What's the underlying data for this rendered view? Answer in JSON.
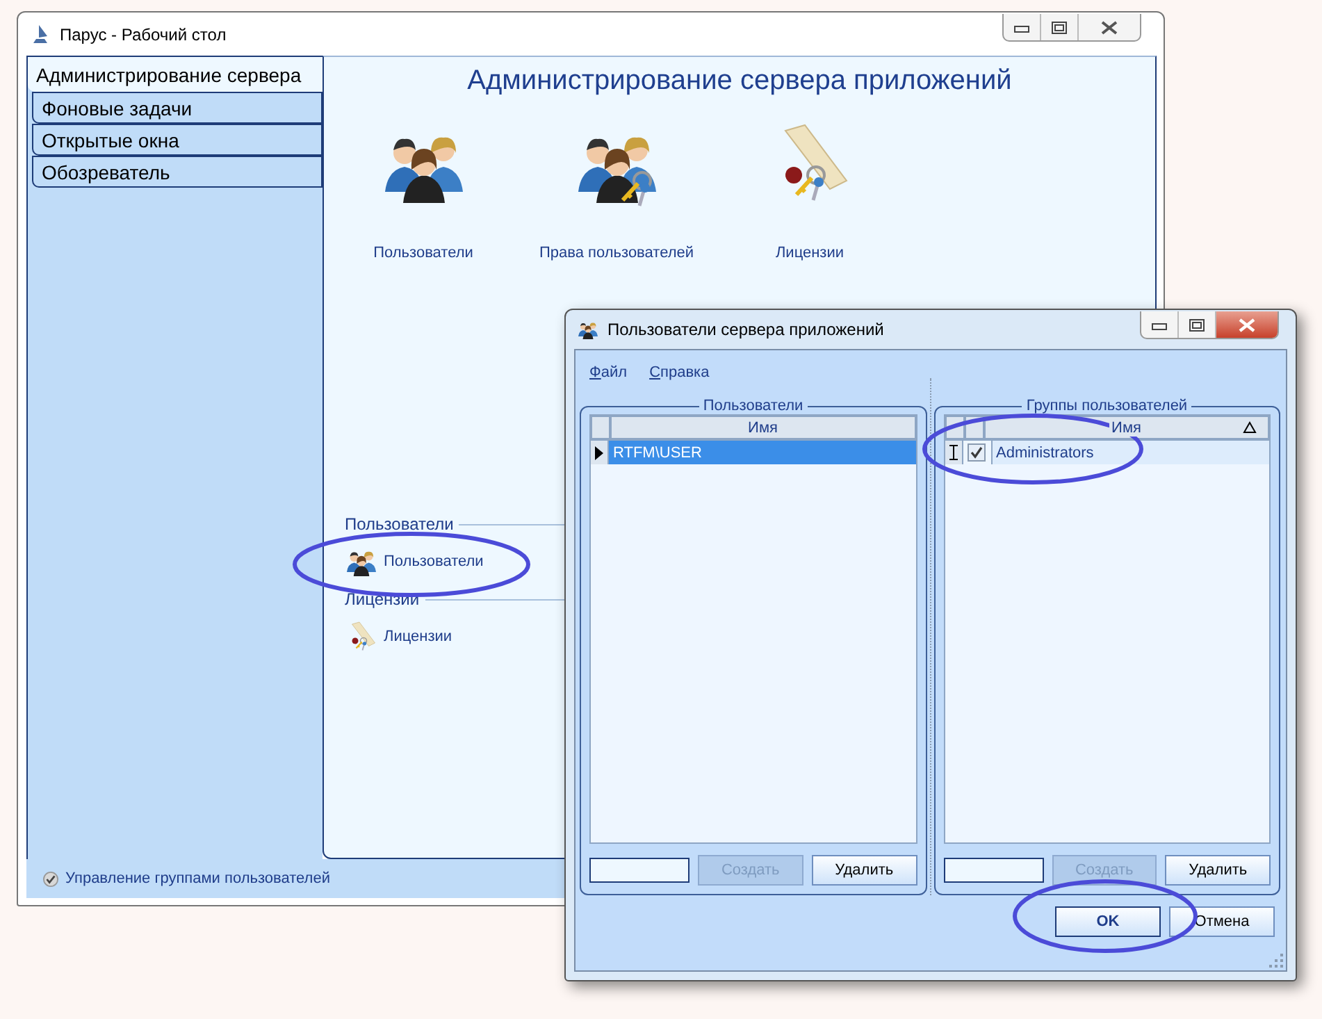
{
  "main_window": {
    "title": "Парус - Рабочий стол"
  },
  "sidebar": {
    "tabs": [
      {
        "label": "Администрирование сервера",
        "selected": true
      },
      {
        "label": "Фоновые задачи",
        "selected": false
      },
      {
        "label": "Открытые окна",
        "selected": false
      },
      {
        "label": "Обозреватель",
        "selected": false
      }
    ]
  },
  "content": {
    "heading": "Администрирование сервера приложений",
    "tiles": [
      {
        "label": "Пользователи",
        "kind": "users"
      },
      {
        "label": "Права пользователей",
        "kind": "rights"
      },
      {
        "label": "Лицензии",
        "kind": "licenses"
      }
    ],
    "sections": [
      {
        "title": "Пользователи",
        "items": [
          {
            "label": "Пользователи",
            "kind": "users"
          }
        ]
      },
      {
        "title": "Лицензии",
        "items": [
          {
            "label": "Лицензии",
            "kind": "licenses"
          }
        ]
      }
    ]
  },
  "status_bar": {
    "text": "Управление группами пользователей"
  },
  "dialog": {
    "title": "Пользователи сервера приложений",
    "menu": [
      "Файл",
      "Справка"
    ],
    "users_panel": {
      "title": "Пользователи",
      "columns": [
        {
          "label": "Имя",
          "sorted": false
        }
      ],
      "rows": [
        {
          "name": "RTFM\\USER",
          "selected": true
        }
      ],
      "buttons": [
        {
          "label": "Создать",
          "disabled": true
        },
        {
          "label": "Удалить",
          "disabled": false
        }
      ]
    },
    "groups_panel": {
      "title": "Группы пользователей",
      "columns": [
        {
          "label": "Имя",
          "sorted": true
        }
      ],
      "rows": [
        {
          "name": "Administrators",
          "checked": true,
          "selected": false
        }
      ],
      "buttons": [
        {
          "label": "Создать",
          "disabled": true
        },
        {
          "label": "Удалить",
          "disabled": false
        }
      ]
    },
    "ok": "OK",
    "cancel": "Отмена"
  }
}
